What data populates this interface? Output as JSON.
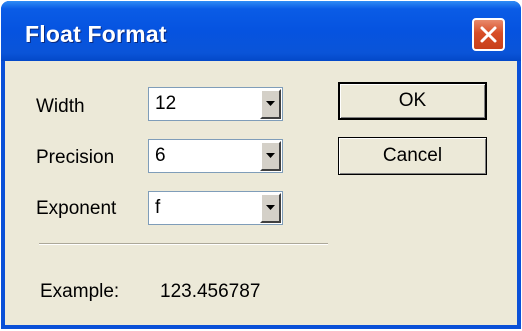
{
  "dialog": {
    "title": "Float Format",
    "fields": {
      "width": {
        "label": "Width",
        "value": "12"
      },
      "precision": {
        "label": "Precision",
        "value": "6"
      },
      "exponent": {
        "label": "Exponent",
        "value": "f"
      }
    },
    "buttons": {
      "ok": "OK",
      "cancel": "Cancel"
    },
    "example": {
      "label": "Example:",
      "value": "123.456787"
    }
  },
  "icons": {
    "close": "close-icon",
    "dropdown": "chevron-down-icon"
  },
  "colors": {
    "title_bar": "#0a54d8",
    "close_button": "#d84e27",
    "dialog_face": "#ece9d8"
  }
}
